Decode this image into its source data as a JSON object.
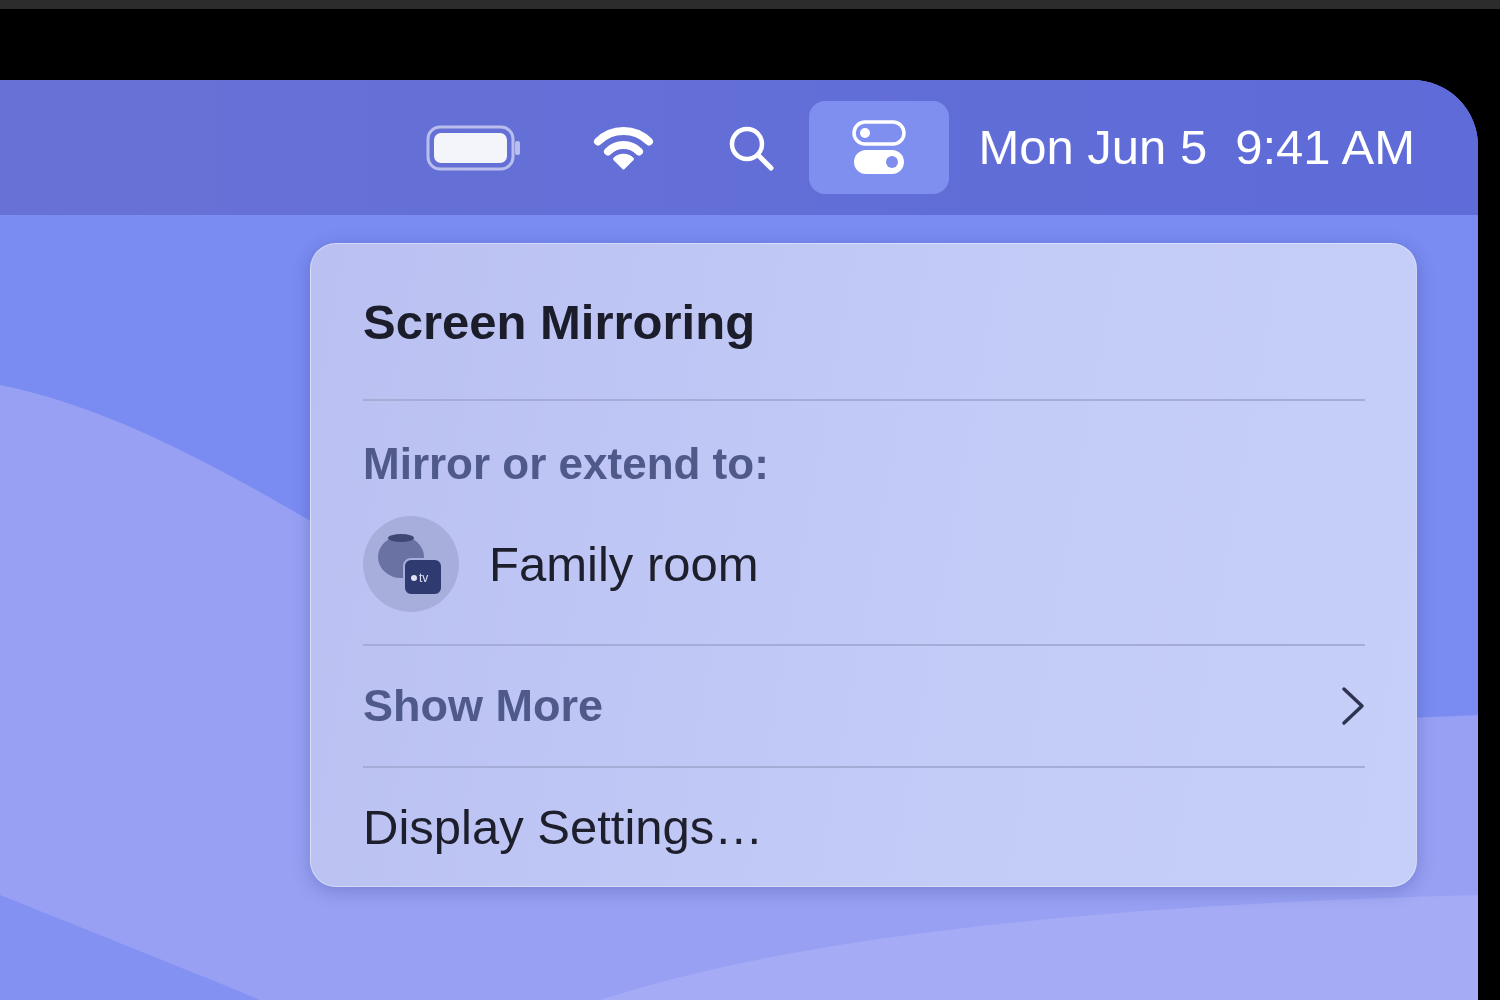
{
  "menu_bar": {
    "status_items": [
      {
        "kind": "battery",
        "selected": false
      },
      {
        "kind": "wifi",
        "selected": false
      },
      {
        "kind": "search",
        "selected": false
      },
      {
        "kind": "control_center",
        "selected": true
      }
    ],
    "date": "Mon Jun 5",
    "time": "9:41 AM"
  },
  "panel": {
    "title": "Screen Mirroring",
    "section_label": "Mirror or extend to:",
    "devices": [
      {
        "name": "Family room",
        "badge": "tv"
      }
    ],
    "show_more": "Show More",
    "settings_item": "Display Settings…"
  }
}
